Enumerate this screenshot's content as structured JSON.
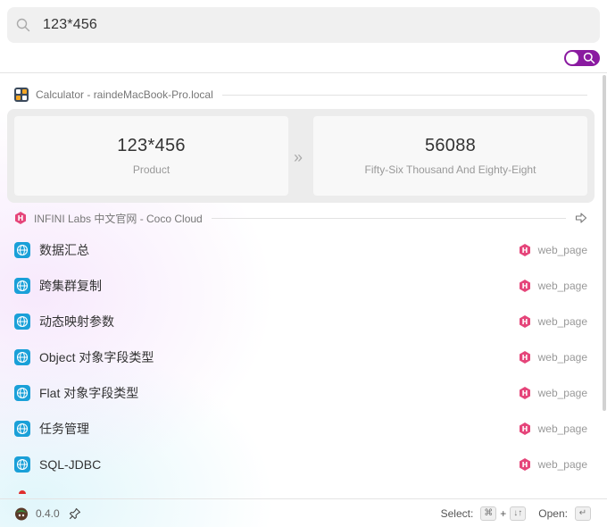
{
  "search": {
    "query": "123*456",
    "icon": "search-icon"
  },
  "calculator": {
    "header": "Calculator - raindeMacBook-Pro.local",
    "expression": "123*456",
    "expression_label": "Product",
    "result": "56088",
    "result_words": "Fifty-Six Thousand And Eighty-Eight",
    "arrow": "»"
  },
  "web_section": {
    "header": "INFINI Labs 中文官网 - Coco Cloud",
    "items": [
      {
        "title": "数据汇总",
        "type": "web_page"
      },
      {
        "title": "跨集群复制",
        "type": "web_page"
      },
      {
        "title": "动态映射参数",
        "type": "web_page"
      },
      {
        "title": "Object 对象字段类型",
        "type": "web_page"
      },
      {
        "title": "Flat 对象字段类型",
        "type": "web_page"
      },
      {
        "title": "任务管理",
        "type": "web_page"
      },
      {
        "title": "SQL-JDBC",
        "type": "web_page"
      }
    ]
  },
  "footer": {
    "version": "0.4.0",
    "select_label": "Select:",
    "select_key1": "⌘",
    "plus": "+",
    "select_key2": "↓↑",
    "open_label": "Open:",
    "open_key": "↵"
  },
  "colors": {
    "accent": "#8a1aa0",
    "badge": "#e5457a",
    "globe": "#1aa0d8"
  }
}
